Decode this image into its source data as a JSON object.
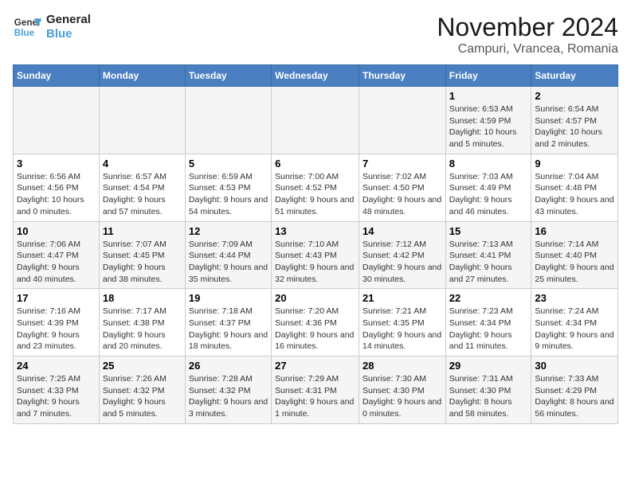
{
  "logo": {
    "line1": "General",
    "line2": "Blue"
  },
  "title": "November 2024",
  "subtitle": "Campuri, Vrancea, Romania",
  "days_of_week": [
    "Sunday",
    "Monday",
    "Tuesday",
    "Wednesday",
    "Thursday",
    "Friday",
    "Saturday"
  ],
  "weeks": [
    [
      {
        "day": "",
        "info": ""
      },
      {
        "day": "",
        "info": ""
      },
      {
        "day": "",
        "info": ""
      },
      {
        "day": "",
        "info": ""
      },
      {
        "day": "",
        "info": ""
      },
      {
        "day": "1",
        "info": "Sunrise: 6:53 AM\nSunset: 4:59 PM\nDaylight: 10 hours and 5 minutes."
      },
      {
        "day": "2",
        "info": "Sunrise: 6:54 AM\nSunset: 4:57 PM\nDaylight: 10 hours and 2 minutes."
      }
    ],
    [
      {
        "day": "3",
        "info": "Sunrise: 6:56 AM\nSunset: 4:56 PM\nDaylight: 10 hours and 0 minutes."
      },
      {
        "day": "4",
        "info": "Sunrise: 6:57 AM\nSunset: 4:54 PM\nDaylight: 9 hours and 57 minutes."
      },
      {
        "day": "5",
        "info": "Sunrise: 6:59 AM\nSunset: 4:53 PM\nDaylight: 9 hours and 54 minutes."
      },
      {
        "day": "6",
        "info": "Sunrise: 7:00 AM\nSunset: 4:52 PM\nDaylight: 9 hours and 51 minutes."
      },
      {
        "day": "7",
        "info": "Sunrise: 7:02 AM\nSunset: 4:50 PM\nDaylight: 9 hours and 48 minutes."
      },
      {
        "day": "8",
        "info": "Sunrise: 7:03 AM\nSunset: 4:49 PM\nDaylight: 9 hours and 46 minutes."
      },
      {
        "day": "9",
        "info": "Sunrise: 7:04 AM\nSunset: 4:48 PM\nDaylight: 9 hours and 43 minutes."
      }
    ],
    [
      {
        "day": "10",
        "info": "Sunrise: 7:06 AM\nSunset: 4:47 PM\nDaylight: 9 hours and 40 minutes."
      },
      {
        "day": "11",
        "info": "Sunrise: 7:07 AM\nSunset: 4:45 PM\nDaylight: 9 hours and 38 minutes."
      },
      {
        "day": "12",
        "info": "Sunrise: 7:09 AM\nSunset: 4:44 PM\nDaylight: 9 hours and 35 minutes."
      },
      {
        "day": "13",
        "info": "Sunrise: 7:10 AM\nSunset: 4:43 PM\nDaylight: 9 hours and 32 minutes."
      },
      {
        "day": "14",
        "info": "Sunrise: 7:12 AM\nSunset: 4:42 PM\nDaylight: 9 hours and 30 minutes."
      },
      {
        "day": "15",
        "info": "Sunrise: 7:13 AM\nSunset: 4:41 PM\nDaylight: 9 hours and 27 minutes."
      },
      {
        "day": "16",
        "info": "Sunrise: 7:14 AM\nSunset: 4:40 PM\nDaylight: 9 hours and 25 minutes."
      }
    ],
    [
      {
        "day": "17",
        "info": "Sunrise: 7:16 AM\nSunset: 4:39 PM\nDaylight: 9 hours and 23 minutes."
      },
      {
        "day": "18",
        "info": "Sunrise: 7:17 AM\nSunset: 4:38 PM\nDaylight: 9 hours and 20 minutes."
      },
      {
        "day": "19",
        "info": "Sunrise: 7:18 AM\nSunset: 4:37 PM\nDaylight: 9 hours and 18 minutes."
      },
      {
        "day": "20",
        "info": "Sunrise: 7:20 AM\nSunset: 4:36 PM\nDaylight: 9 hours and 16 minutes."
      },
      {
        "day": "21",
        "info": "Sunrise: 7:21 AM\nSunset: 4:35 PM\nDaylight: 9 hours and 14 minutes."
      },
      {
        "day": "22",
        "info": "Sunrise: 7:23 AM\nSunset: 4:34 PM\nDaylight: 9 hours and 11 minutes."
      },
      {
        "day": "23",
        "info": "Sunrise: 7:24 AM\nSunset: 4:34 PM\nDaylight: 9 hours and 9 minutes."
      }
    ],
    [
      {
        "day": "24",
        "info": "Sunrise: 7:25 AM\nSunset: 4:33 PM\nDaylight: 9 hours and 7 minutes."
      },
      {
        "day": "25",
        "info": "Sunrise: 7:26 AM\nSunset: 4:32 PM\nDaylight: 9 hours and 5 minutes."
      },
      {
        "day": "26",
        "info": "Sunrise: 7:28 AM\nSunset: 4:32 PM\nDaylight: 9 hours and 3 minutes."
      },
      {
        "day": "27",
        "info": "Sunrise: 7:29 AM\nSunset: 4:31 PM\nDaylight: 9 hours and 1 minute."
      },
      {
        "day": "28",
        "info": "Sunrise: 7:30 AM\nSunset: 4:30 PM\nDaylight: 9 hours and 0 minutes."
      },
      {
        "day": "29",
        "info": "Sunrise: 7:31 AM\nSunset: 4:30 PM\nDaylight: 8 hours and 58 minutes."
      },
      {
        "day": "30",
        "info": "Sunrise: 7:33 AM\nSunset: 4:29 PM\nDaylight: 8 hours and 56 minutes."
      }
    ]
  ]
}
